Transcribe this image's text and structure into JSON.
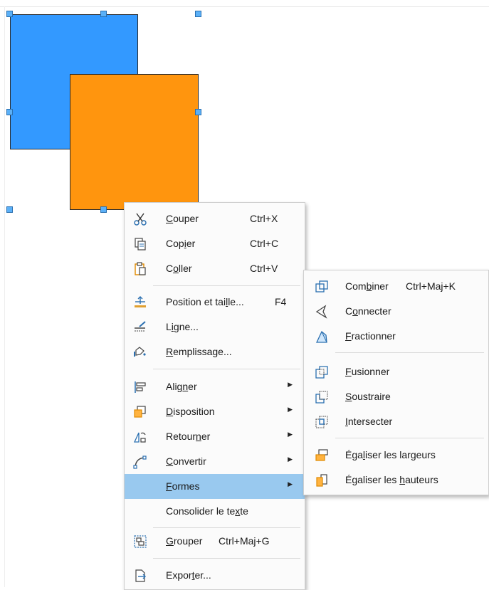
{
  "colors": {
    "blue_shape": "#3399ff",
    "orange_shape": "#ff950e",
    "handle": "#5bb0f7",
    "highlight": "#99c9ef"
  },
  "context_menu": {
    "items": [
      {
        "label": "Couper",
        "mnemonic": "C",
        "shortcut": "Ctrl+X",
        "icon": "scissors-icon"
      },
      {
        "label": "Copier",
        "mnemonic": "i",
        "shortcut": "Ctrl+C",
        "icon": "copy-icon"
      },
      {
        "label": "Coller",
        "mnemonic": "o",
        "shortcut": "Ctrl+V",
        "icon": "paste-icon"
      },
      {
        "label": "Position et taille...",
        "mnemonic": "l",
        "shortcut": "F4",
        "icon": "position-size-icon"
      },
      {
        "label": "Ligne...",
        "mnemonic": "i",
        "icon": "line-icon"
      },
      {
        "label": "Remplissage...",
        "mnemonic": "R",
        "icon": "fill-icon"
      },
      {
        "label": "Aligner",
        "mnemonic": "n",
        "icon": "align-icon",
        "submenu": true
      },
      {
        "label": "Disposition",
        "mnemonic": "D",
        "icon": "arrange-icon",
        "submenu": true
      },
      {
        "label": "Retourner",
        "mnemonic": "n",
        "icon": "flip-icon",
        "submenu": true
      },
      {
        "label": "Convertir",
        "mnemonic": "C",
        "icon": "convert-icon",
        "submenu": true
      },
      {
        "label": "Formes",
        "mnemonic": "F",
        "icon": "",
        "submenu": true,
        "highlighted": true
      },
      {
        "label": "Consolider le texte",
        "mnemonic": "x",
        "icon": ""
      },
      {
        "label": "Grouper",
        "mnemonic": "G",
        "shortcut": "Ctrl+Maj+G",
        "icon": "group-icon"
      },
      {
        "label": "Exporter...",
        "mnemonic": "t",
        "icon": "export-icon"
      }
    ]
  },
  "shapes_submenu": {
    "items": [
      {
        "label": "Combiner",
        "mnemonic": "b",
        "shortcut": "Ctrl+Maj+K",
        "icon": "combine-icon"
      },
      {
        "label": "Connecter",
        "mnemonic": "o",
        "icon": "connect-icon"
      },
      {
        "label": "Fractionner",
        "mnemonic": "F",
        "icon": "split-icon"
      },
      {
        "label": "Fusionner",
        "mnemonic": "F",
        "icon": "merge-icon"
      },
      {
        "label": "Soustraire",
        "mnemonic": "S",
        "icon": "subtract-icon"
      },
      {
        "label": "Intersecter",
        "mnemonic": "I",
        "icon": "intersect-icon"
      },
      {
        "label": "Égaliser les largeurs",
        "mnemonic": "l",
        "icon": "equal-width-icon"
      },
      {
        "label": "Égaliser les hauteurs",
        "mnemonic": "h",
        "icon": "equal-height-icon"
      }
    ]
  }
}
